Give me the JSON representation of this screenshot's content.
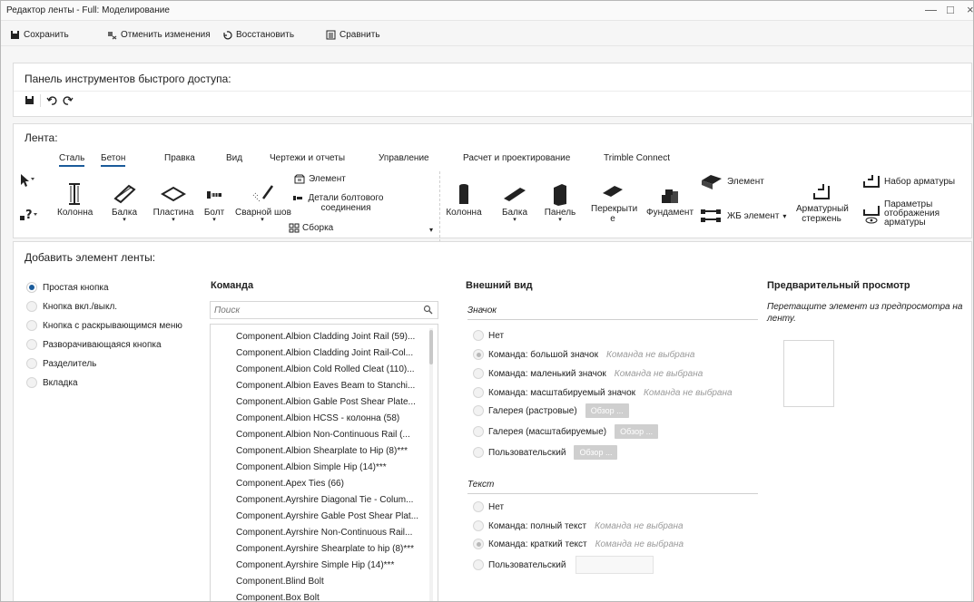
{
  "window": {
    "title": "Редактор ленты - Full: Моделирование",
    "controls": {
      "minimize": "—",
      "maximize": "□",
      "close": "×"
    }
  },
  "toolbar": {
    "save": "Сохранить",
    "undo_changes": "Отменить изменения",
    "restore": "Восстановить",
    "compare": "Сравнить"
  },
  "qat": {
    "title": "Панель инструментов быстрого доступа:",
    "icons": [
      "save-icon",
      "undo-icon",
      "redo-icon"
    ]
  },
  "ribbon": {
    "title": "Лента:",
    "tabs": [
      {
        "label": "Сталь",
        "active": true
      },
      {
        "label": "Бетон",
        "active": false
      },
      {
        "label": "Правка",
        "active": false
      },
      {
        "label": "Вид",
        "active": false
      },
      {
        "label": "Чертежи и отчеты",
        "active": false
      },
      {
        "label": "Управление",
        "active": false
      },
      {
        "label": "Расчет и проектирование",
        "active": false
      },
      {
        "label": "Trimble Connect",
        "active": false
      }
    ],
    "steel_buttons": {
      "column": "Колонна",
      "beam": "Балка",
      "plate": "Пластина",
      "bolt": "Болт",
      "weld": "Сварной шов",
      "element": "Элемент",
      "bolt_details": "Детали болтового соединения",
      "assembly": "Сборка"
    },
    "concrete_buttons": {
      "column": "Колонна",
      "beam": "Балка",
      "panel": "Панель",
      "slab": "Перекрыти е",
      "foundation": "Фундамент",
      "element": "Элемент",
      "rc_element": "ЖБ элемент",
      "rebar": "Арматурный стержень",
      "rebar_set": "Набор арматуры",
      "rebar_display": "Параметры отображения арматуры"
    }
  },
  "add_element": {
    "title": "Добавить элемент ленты:",
    "types": [
      {
        "label": "Простая кнопка",
        "selected": true
      },
      {
        "label": "Кнопка вкл./выкл.",
        "selected": false
      },
      {
        "label": "Кнопка с раскрывающимся меню",
        "selected": false
      },
      {
        "label": "Разворачивающаяся кнопка",
        "selected": false
      },
      {
        "label": "Разделитель",
        "selected": false
      },
      {
        "label": "Вкладка",
        "selected": false
      }
    ],
    "command": {
      "header": "Команда",
      "search_placeholder": "Поиск",
      "items": [
        "Component.Albion Cladding Joint Rail (59)...",
        "Component.Albion Cladding Joint Rail-Col...",
        "Component.Albion Cold Rolled Cleat (110)...",
        "Component.Albion Eaves Beam to Stanchi...",
        "Component.Albion Gable Post Shear Plate...",
        "Component.Albion HCSS - колонна (58)",
        "Component.Albion Non-Continuous Rail (...",
        "Component.Albion Shearplate to Hip (8)***",
        "Component.Albion Simple Hip (14)***",
        "Component.Apex Ties (66)",
        "Component.Ayrshire Diagonal Tie - Colum...",
        "Component.Ayrshire Gable Post Shear Plat...",
        "Component.Ayrshire Non-Continuous Rail...",
        "Component.Ayrshire Shearplate to hip (8)***",
        "Component.Ayrshire Simple Hip (14)***",
        "Component.Blind Bolt",
        "Component.Box Bolt"
      ]
    },
    "appearance": {
      "header": "Внешний вид",
      "icon_section": "Значок",
      "icon_options": {
        "none": "Нет",
        "large": "Команда: большой значок",
        "small": "Команда: маленький значок",
        "scalable": "Команда: масштабируемый значок",
        "gallery_raster": "Галерея (растровые)",
        "gallery_scalable": "Галерея (масштабируемые)",
        "custom": "Пользовательский"
      },
      "no_command": "Команда не выбрана",
      "browse": "Обзор ...",
      "text_section": "Текст",
      "text_options": {
        "none": "Нет",
        "full": "Команда: полный текст",
        "short": "Команда: краткий текст",
        "custom": "Пользовательский"
      }
    },
    "preview": {
      "header": "Предварительный просмотр",
      "hint": "Перетащите элемент из предпросмотра на ленту."
    }
  },
  "colors": {
    "accent": "#1a5b9a",
    "panel_border": "#dcdcdc",
    "browse_bg": "#cfcfcf"
  }
}
